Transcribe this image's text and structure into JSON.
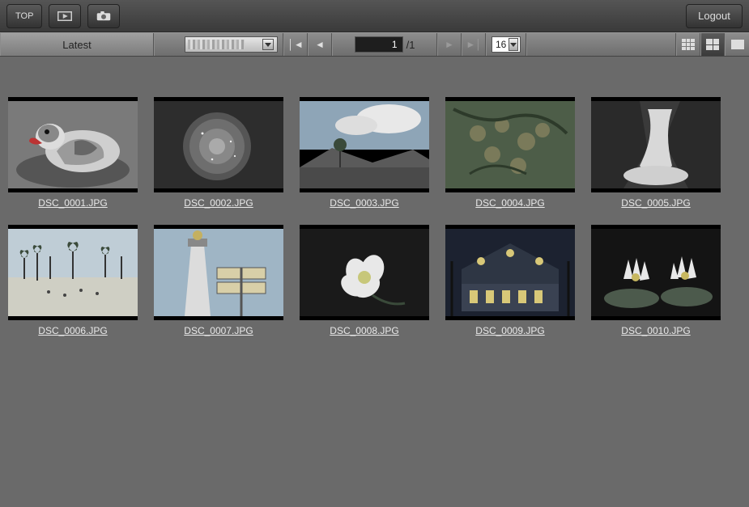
{
  "topbar": {
    "top_label": "TOP",
    "logout_label": "Logout"
  },
  "nav": {
    "latest_label": "Latest",
    "page_current": "1",
    "page_total": "/1",
    "per_page": "16"
  },
  "thumbs": [
    {
      "filename": "DSC_0001.JPG"
    },
    {
      "filename": "DSC_0002.JPG"
    },
    {
      "filename": "DSC_0003.JPG"
    },
    {
      "filename": "DSC_0004.JPG"
    },
    {
      "filename": "DSC_0005.JPG"
    },
    {
      "filename": "DSC_0006.JPG"
    },
    {
      "filename": "DSC_0007.JPG"
    },
    {
      "filename": "DSC_0008.JPG"
    },
    {
      "filename": "DSC_0009.JPG"
    },
    {
      "filename": "DSC_0010.JPG"
    }
  ]
}
